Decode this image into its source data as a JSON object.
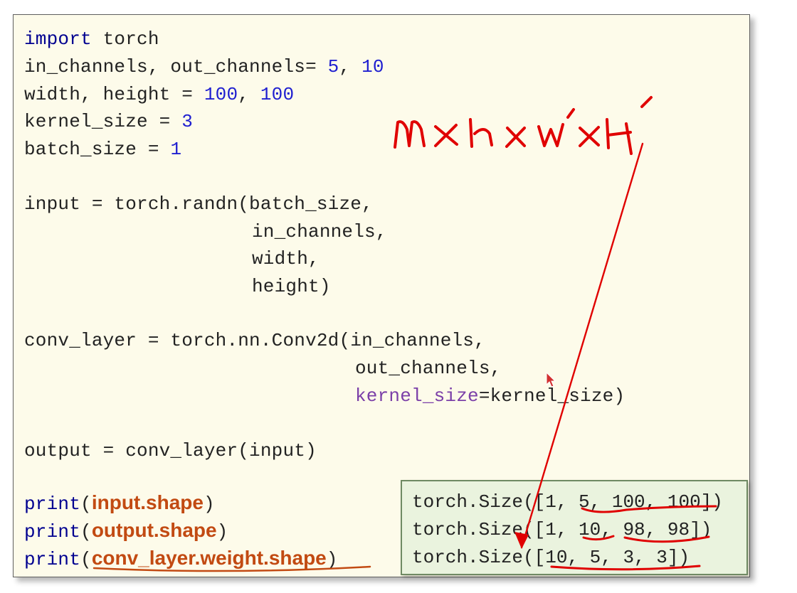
{
  "code": {
    "line1": {
      "kw": "import",
      "rest": " torch"
    },
    "line2": {
      "text": "in_channels, out_channels= ",
      "n1": "5",
      "sep": ", ",
      "n2": "10"
    },
    "line3": {
      "text": "width, height = ",
      "n1": "100",
      "sep": ", ",
      "n2": "100"
    },
    "line4": {
      "text": "kernel_size = ",
      "n1": "3"
    },
    "line5": {
      "text": "batch_size = ",
      "n1": "1"
    },
    "line6": "input = torch.randn(batch_size,",
    "line7": "in_channels,",
    "line8": "width,",
    "line9": "height)",
    "line10": "conv_layer = torch.nn.Conv2d(in_channels,",
    "line11": "out_channels,",
    "line12": {
      "param": "kernel_size",
      "rest": "=kernel_size)"
    },
    "line13": "output = conv_layer(input)",
    "print_fn": "print",
    "open_paren": "(",
    "close_paren": ")",
    "print1_arg": "input.shape",
    "print2_arg": "output.shape",
    "print3_arg": "conv_layer.weight.shape"
  },
  "output": {
    "line1": "torch.Size([1, 5, 100, 100])",
    "line2": "torch.Size([1, 10, 98, 98])",
    "line3": "torch.Size([10, 5, 3, 3])"
  },
  "colors": {
    "panel_bg": "#fdfbea",
    "keyword": "#000090",
    "number": "#1f1fd0",
    "parameter": "#7b3fa8",
    "highlight": "#c24a12",
    "output_bg": "#eaf3de",
    "annotation": "#e00000"
  },
  "icons": [
    "mouse-cursor-icon",
    "annotation-arrow"
  ]
}
